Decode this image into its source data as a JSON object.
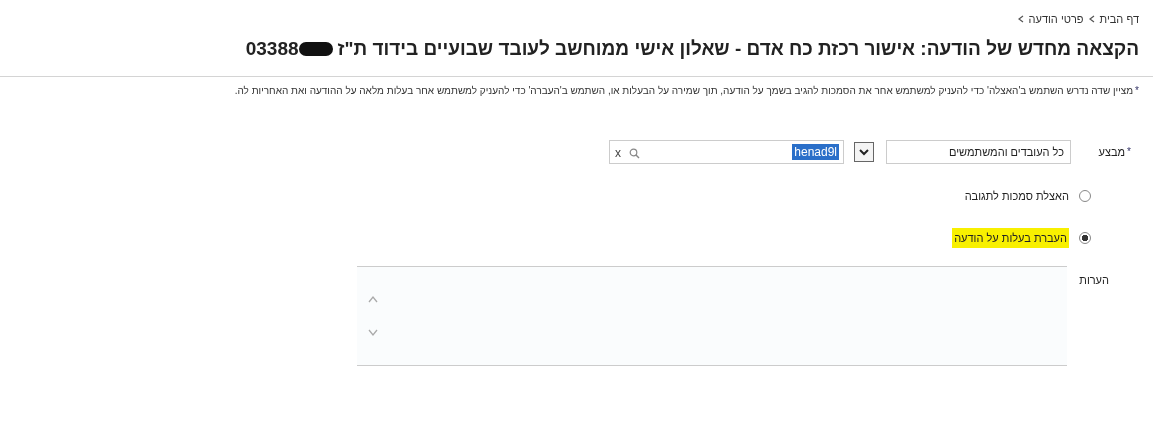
{
  "breadcrumbs": [
    {
      "label": "דף הבית"
    },
    {
      "label": "פרטי הודעה"
    }
  ],
  "title": {
    "text": "הקצאה מחדש של הודעה: אישור רכזת כח אדם - שאלון אישי ממוחשב לעובד שבועיים בידוד ת\"ז",
    "id_number": "03388"
  },
  "instructions": {
    "required_mark": "*",
    "text": "מציין שדה נדרש השתמש ב'האצלה' כדי להעניק למשתמש אחר את הסמכות להגיב בשמך על הודעה, תוך שמירה על הבעלות או, השתמש ב'העברה' כדי להעניק למשתמש אחר בעלות מלאה על ההודעה ואת האחריות לה."
  },
  "assignee": {
    "label": "מבצע",
    "required": true,
    "scope": "כל העובדים והמשתמשים",
    "search_value": "henad9l",
    "clear": "x"
  },
  "options": [
    {
      "label": "האצלת סמכות לתגובה",
      "selected": false,
      "highlighted": false
    },
    {
      "label": "העברת בעלות על הודעה",
      "selected": true,
      "highlighted": true
    }
  ],
  "comments": {
    "label": "הערות"
  }
}
